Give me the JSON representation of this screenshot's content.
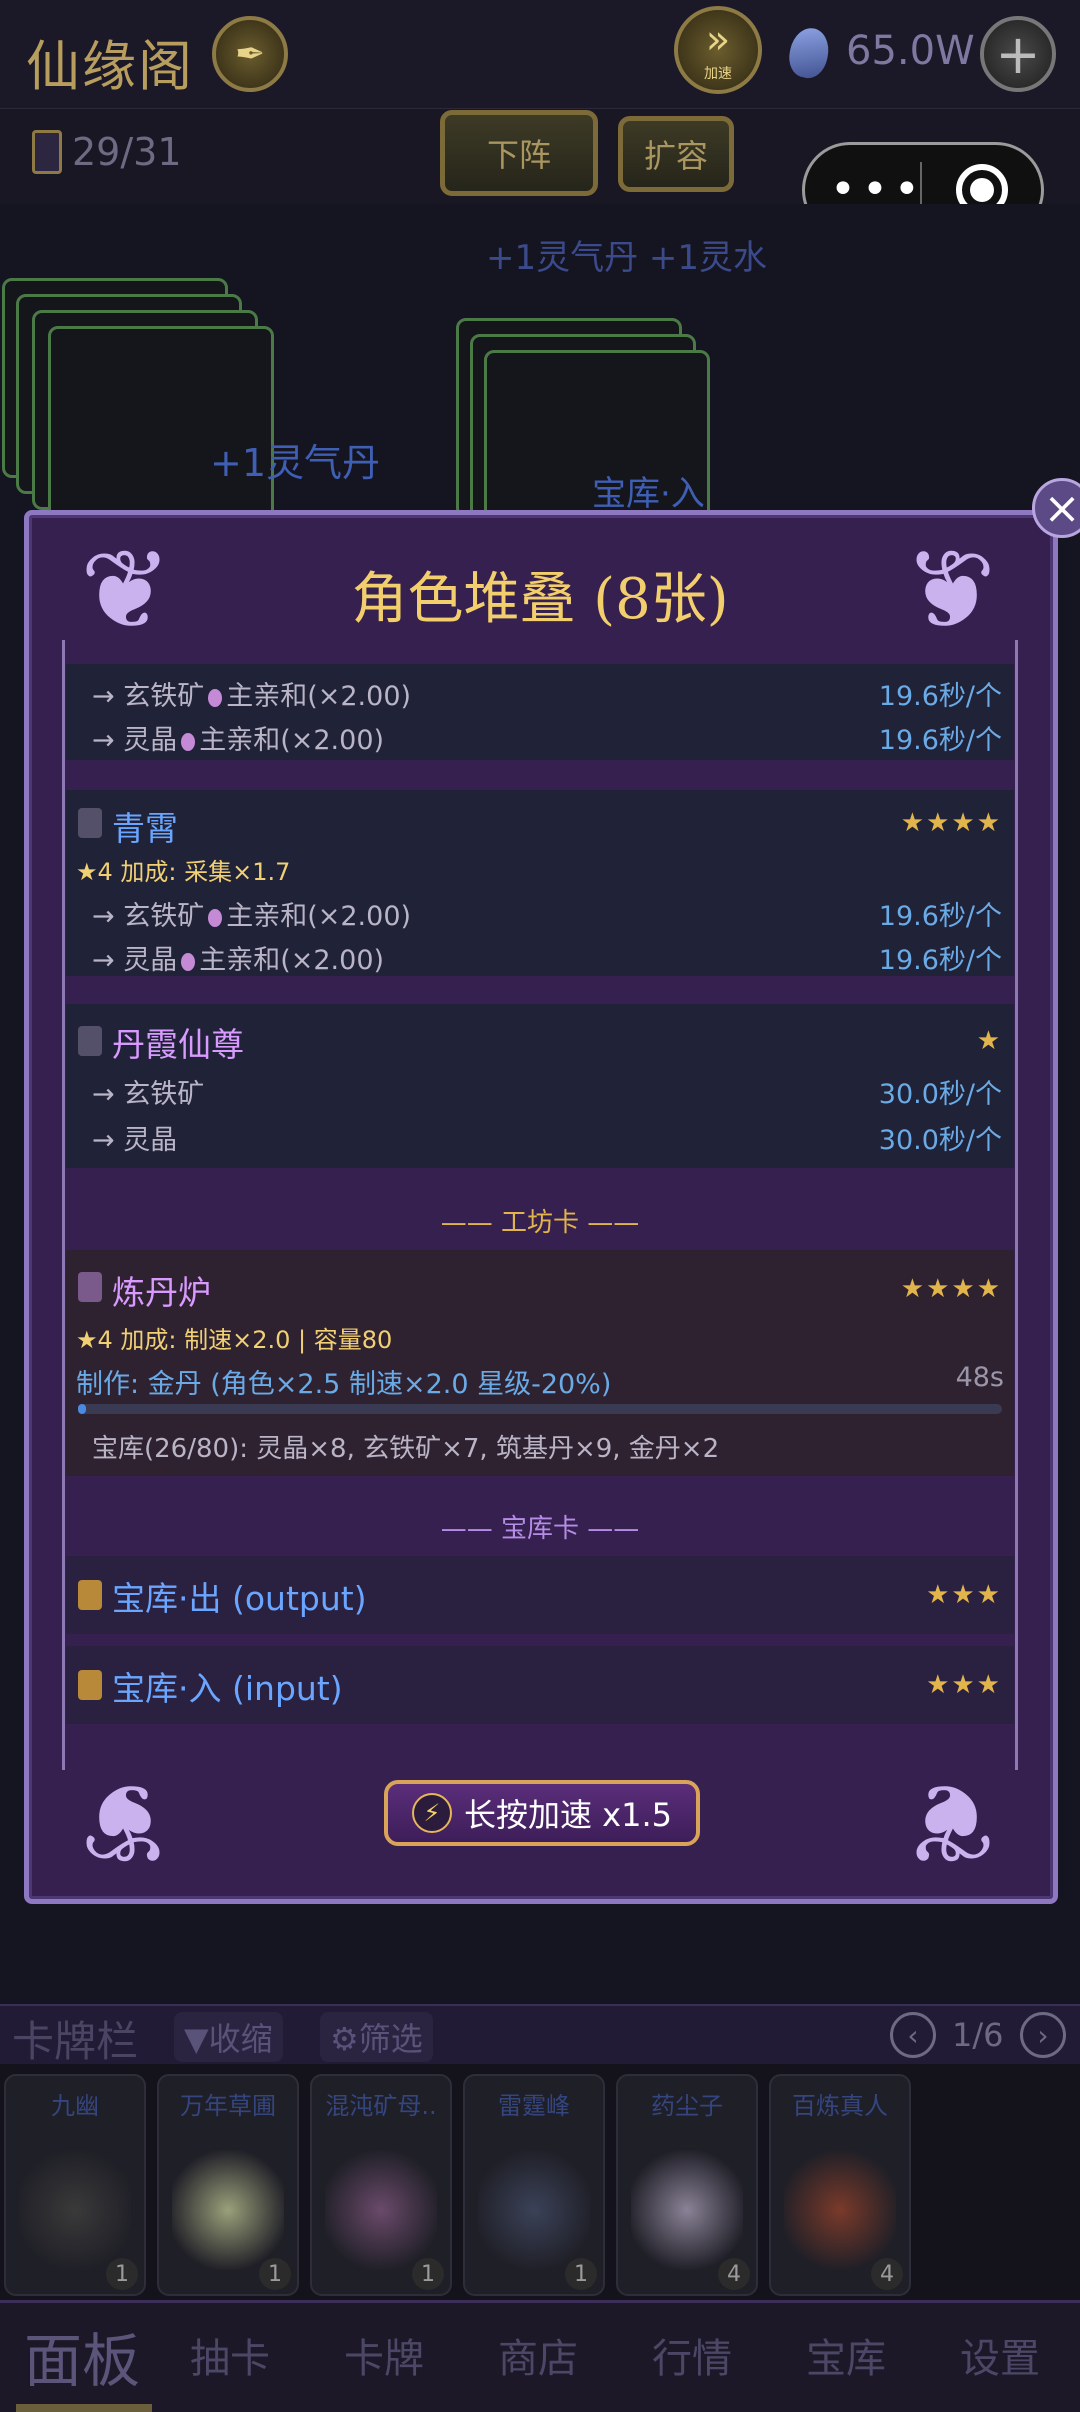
{
  "topbar": {
    "title": "仙缘阁",
    "speed_label": "加速",
    "currency": "65.0W"
  },
  "subbar": {
    "deck_count": "29/31",
    "off_button": "下阵",
    "expand_button": "扩容"
  },
  "board": {
    "floating_1": "+1灵气丹 +1灵水",
    "floating_2": "+1灵气丹",
    "floating_3": "宝库·入"
  },
  "modal": {
    "title": "角色堆叠 (8张)",
    "close_symbol": "×",
    "entries": [
      {
        "rows": [
          {
            "item": "→ 玄铁矿",
            "bonus": "主亲和(×2.00)",
            "rate": "19.6秒/个"
          },
          {
            "item": "→ 灵晶",
            "bonus": "主亲和(×2.00)",
            "rate": "19.6秒/个"
          }
        ]
      },
      {
        "name": "青霄",
        "stars": "★★★★",
        "bonus": "★4 加成: 采集×1.7",
        "rows": [
          {
            "item": "→ 玄铁矿",
            "bonus": "主亲和(×2.00)",
            "rate": "19.6秒/个"
          },
          {
            "item": "→ 灵晶",
            "bonus": "主亲和(×2.00)",
            "rate": "19.6秒/个"
          }
        ]
      },
      {
        "name": "丹霞仙尊",
        "stars": "★",
        "rows": [
          {
            "item": "→ 玄铁矿",
            "rate": "30.0秒/个"
          },
          {
            "item": "→ 灵晶",
            "rate": "30.0秒/个"
          }
        ]
      }
    ],
    "workshop_section": "—— 工坊卡 ——",
    "workshop": {
      "name": "炼丹炉",
      "stars": "★★★★",
      "bonus": "★4 加成: 制速×2.0 | 容量80",
      "crafting": "制作: 金丹 (角色×2.5 制速×2.0 星级-20%)",
      "time": "48s",
      "progress": 0.005,
      "storage": "宝库(26/80): 灵晶×8, 玄铁矿×7, 筑基丹×9, 金丹×2"
    },
    "vault_section": "—— 宝库卡 ——",
    "vaults": [
      {
        "name": "宝库·出 (output)",
        "stars": "★★★"
      },
      {
        "name": "宝库·入 (input)",
        "stars": "★★★"
      }
    ],
    "speed_button": "长按加速 x1.5"
  },
  "cardbar": {
    "title": "卡牌栏",
    "collapse": "▼收缩",
    "filter": "⚙筛选",
    "page": "1/6",
    "cards": [
      {
        "name": "九幽",
        "count": "1",
        "art_color": "#3a3a3a"
      },
      {
        "name": "万年草圃",
        "count": "1",
        "art_color": "#9aa07a"
      },
      {
        "name": "混沌矿母..",
        "count": "1",
        "art_color": "#6a4a6a"
      },
      {
        "name": "雷霆峰",
        "count": "1",
        "art_color": "#3b4258"
      },
      {
        "name": "药尘子",
        "count": "4",
        "art_color": "#8a8296"
      },
      {
        "name": "百炼真人",
        "count": "4",
        "art_color": "#7a3a2a"
      }
    ]
  },
  "bottomnav": {
    "active": "面板",
    "items": [
      "抽卡",
      "卡牌",
      "商店",
      "行情",
      "宝库",
      "设置"
    ]
  },
  "colors": {
    "gold": "#f2cf6c",
    "rate_blue": "#6aaae6",
    "name_blue": "#6aa6ff",
    "name_purple": "#d99aff",
    "modal_bg": "#35204f"
  }
}
